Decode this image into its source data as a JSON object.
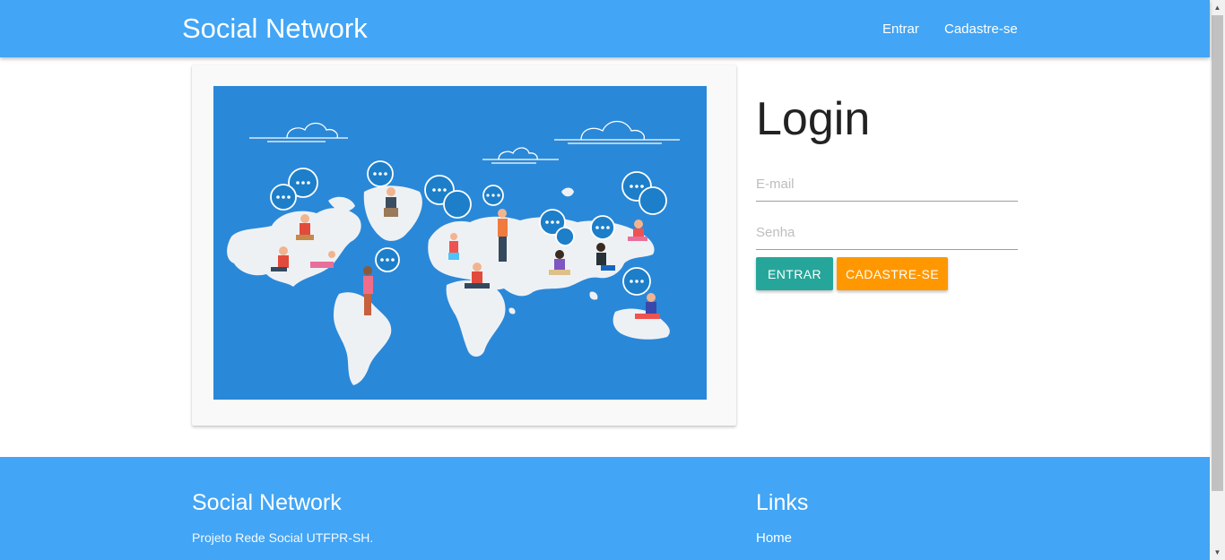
{
  "navbar": {
    "brand": "Social Network",
    "links": [
      "Entrar",
      "Cadastre-se"
    ]
  },
  "login": {
    "title": "Login",
    "email_placeholder": "E-mail",
    "password_placeholder": "Senha",
    "entrar_button": "ENTRAR",
    "cadastre_button": "CADASTRE-SE"
  },
  "footer": {
    "title": "Social Network",
    "description": "Projeto Rede Social UTFPR-SH.",
    "links_title": "Links",
    "home_link": "Home"
  },
  "colors": {
    "primary": "#42a5f5",
    "entrar": "#26a69a",
    "cadastre": "#ff9800",
    "illustration_bg": "#2a88d8"
  },
  "scrollbar": {
    "up_icon": "chevron-up-icon",
    "down_icon": "chevron-down-icon"
  }
}
